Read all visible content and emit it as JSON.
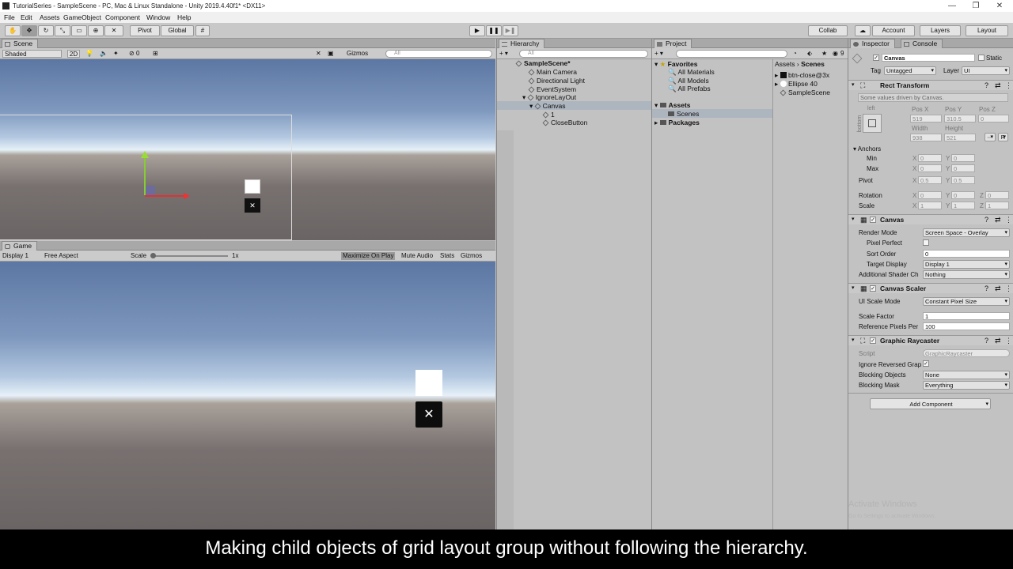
{
  "window": {
    "title": "TutorialSeries - SampleScene - PC, Mac & Linux Standalone - Unity 2019.4.40f1* <DX11>",
    "min": "—",
    "max": "❐",
    "close": "✕"
  },
  "menu": [
    "File",
    "Edit",
    "Assets",
    "GameObject",
    "Component",
    "Window",
    "Help"
  ],
  "toolbar": {
    "pivot": "Pivot",
    "global": "Global",
    "collab": "Collab",
    "account": "Account",
    "layers": "Layers",
    "layout": "Layout",
    "play": "▶",
    "pause": "❚❚",
    "step": "▶❚"
  },
  "scene": {
    "tab": "Scene",
    "shaded": "Shaded",
    "mode2d": "2D",
    "hidden_count": "0",
    "gizmos": "Gizmos",
    "search": "All",
    "close_glyph": "✕"
  },
  "game": {
    "tab": "Game",
    "display": "Display 1",
    "aspect": "Free Aspect",
    "scale_label": "Scale",
    "scale_value": "1x",
    "maximize": "Maximize On Play",
    "mute": "Mute Audio",
    "stats": "Stats",
    "gizmos": "Gizmos",
    "close_glyph": "✕"
  },
  "hierarchy": {
    "tab": "Hierarchy",
    "search": "All",
    "scene": "SampleScene*",
    "items": [
      "Main Camera",
      "Directional Light",
      "EventSystem",
      "IgnoreLayOut",
      "Canvas",
      "1",
      "CloseButton"
    ]
  },
  "project": {
    "tab": "Project",
    "favorites": "Favorites",
    "fav_items": [
      "All Materials",
      "All Models",
      "All Prefabs"
    ],
    "assets": "Assets",
    "scenes": "Scenes",
    "packages": "Packages",
    "breadcrumb_assets": "Assets",
    "breadcrumb_sep": "›",
    "breadcrumb_scenes": "Scenes",
    "files": [
      "btn-close@3x",
      "Ellipse 40",
      "SampleScene"
    ],
    "hidden_count": "9"
  },
  "inspector": {
    "tab": "Inspector",
    "console_tab": "Console",
    "object_name": "Canvas",
    "static": "Static",
    "tag_label": "Tag",
    "tag": "Untagged",
    "layer_label": "Layer",
    "layer": "UI",
    "rect_transform": {
      "title": "Rect Transform",
      "note": "Some values driven by Canvas.",
      "anchor_h": "left",
      "anchor_v": "bottom",
      "posx_label": "Pos X",
      "posy_label": "Pos Y",
      "posz_label": "Pos Z",
      "posx": "519",
      "posy": "310.5",
      "posz": "0",
      "width_label": "Width",
      "height_label": "Height",
      "width": "938",
      "height": "521",
      "r_button": "R",
      "anchors": "Anchors",
      "min": "Min",
      "max": "Max",
      "pivot": "Pivot",
      "rotation": "Rotation",
      "scale": "Scale",
      "min_x": "0",
      "min_y": "0",
      "max_x": "0",
      "max_y": "0",
      "pivot_x": "0.5",
      "pivot_y": "0.5",
      "rot_x": "0",
      "rot_y": "0",
      "rot_z": "0",
      "scale_x": "1",
      "scale_y": "1",
      "scale_z": "1"
    },
    "canvas": {
      "title": "Canvas",
      "render_mode_label": "Render Mode",
      "render_mode": "Screen Space - Overlay",
      "pixel_perfect": "Pixel Perfect",
      "sort_order_label": "Sort Order",
      "sort_order": "0",
      "target_display_label": "Target Display",
      "target_display": "Display 1",
      "shader_label": "Additional Shader Ch",
      "shader": "Nothing"
    },
    "scaler": {
      "title": "Canvas Scaler",
      "mode_label": "UI Scale Mode",
      "mode": "Constant Pixel Size",
      "factor_label": "Scale Factor",
      "factor": "1",
      "ref_label": "Reference Pixels Per",
      "ref": "100"
    },
    "raycaster": {
      "title": "Graphic Raycaster",
      "script_label": "Script",
      "script": "GraphicRaycaster",
      "ignore_label": "Ignore Reversed Grap",
      "blocking_label": "Blocking Objects",
      "blocking": "None",
      "mask_label": "Blocking Mask",
      "mask": "Everything"
    },
    "add_component": "Add Component",
    "watermark1": "Activate Windows",
    "watermark2": "Go to Settings to activate Windows."
  },
  "subtitle": "Making child objects of grid layout group without following the hierarchy.",
  "colors": {
    "selection": "#adb5bf",
    "sky_top": "#5c77a3",
    "horizon": "#e6f0f8",
    "ground": "#6a6464"
  }
}
